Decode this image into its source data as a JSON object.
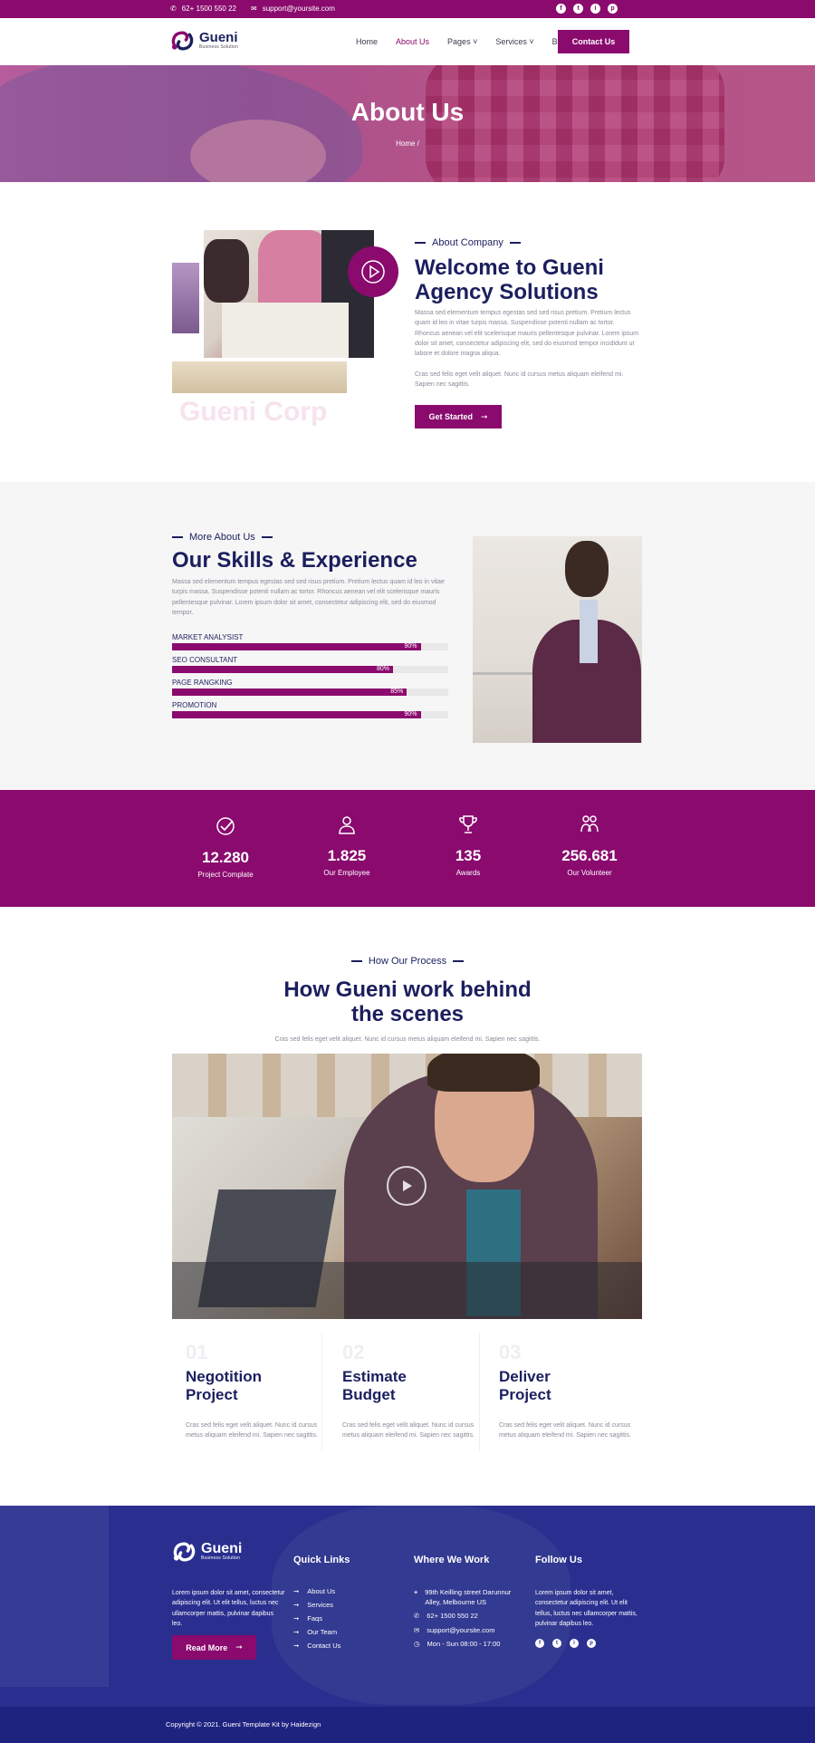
{
  "topbar": {
    "phone": "62+ 1500 550 22",
    "email": "support@yoursite.com",
    "social": [
      "f",
      "t",
      "i",
      "p"
    ]
  },
  "brand": {
    "name": "Gueni",
    "tagline": "Business Solution"
  },
  "nav": {
    "items": [
      {
        "label": "Home"
      },
      {
        "label": "About Us",
        "active": true
      },
      {
        "label": "Pages ˅"
      },
      {
        "label": "Services ˅"
      },
      {
        "label": "Blog"
      }
    ],
    "contact_label": "Contact Us"
  },
  "hero": {
    "title": "About Us",
    "crumb_home": "Home /",
    "crumb_current": ""
  },
  "about": {
    "eyebrow": "About Company",
    "title_line1": "Welcome to Gueni",
    "title_line2": "Agency Solutions",
    "para1": "Massa sed elementum tempus egestas sed sed risus pretium. Pretium lectus quam id leo in vitae turpis massa. Suspendisse potenti nullam ac tortor. Rhoncus aenean vel elit scelerisque mauris pellentesque pulvinar. Lorem ipsum dolor sit amet, consectetur adipiscing elit, sed do eiusmod tempor incididunt ut labore et dolore magna aliqua.",
    "para2": "Cras sed felis eget velit aliquet. Nunc id cursus metus aliquam eleifend mi. Sapien nec sagittis.",
    "cta": "Get Started",
    "watermark": "Gueni Corp"
  },
  "skills": {
    "eyebrow": "More About Us",
    "title": "Our Skills & Experience",
    "para": "Massa sed elementum tempus egestas sed sed risus pretium. Pretium lectus quam id leo in vitae turpis massa. Suspendisse potenti nullam ac tortor. Rhoncus aenean vel elit scelerisque mauris pellentesque pulvinar. Lorem ipsum dolor sit amet, consectetur adipiscing elit, sed do eiusmod tempor.",
    "bars": [
      {
        "label": "MARKET ANALYSIST",
        "value": 90,
        "pct": "90%"
      },
      {
        "label": "SEO CONSULTANT",
        "value": 80,
        "pct": "80%"
      },
      {
        "label": "PAGE RANGKING",
        "value": 85,
        "pct": "85%"
      },
      {
        "label": "PROMOTION",
        "value": 90,
        "pct": "90%"
      }
    ]
  },
  "counters": [
    {
      "num": "12.280",
      "label": "Project Complate",
      "icon": "badge-check-icon"
    },
    {
      "num": "1.825",
      "label": "Our Employee",
      "icon": "employee-icon"
    },
    {
      "num": "135",
      "label": "Awards",
      "icon": "trophy-icon"
    },
    {
      "num": "256.681",
      "label": "Our Volunteer",
      "icon": "volunteer-icon"
    }
  ],
  "process": {
    "eyebrow": "How Our Process",
    "title_line1": "How Gueni work behind",
    "title_line2": "the scenes",
    "subtitle": "Cras sed felis eget velit aliquet. Nunc id cursus metus aliquam eleifend mi. Sapien nec sagittis.",
    "steps": [
      {
        "num": "01",
        "title1": "Negotition",
        "title2": "Project",
        "desc": "Cras sed felis eget velit aliquet. Nunc id cursus metus aliquam eleifend mi. Sapien nec sagittis."
      },
      {
        "num": "02",
        "title1": "Estimate",
        "title2": "Budget",
        "desc": "Cras sed felis eget velit aliquet. Nunc id cursus metus aliquam eleifend mi. Sapien nec sagittis."
      },
      {
        "num": "03",
        "title1": "Deliver",
        "title2": "Project",
        "desc": "Cras sed felis eget velit aliquet. Nunc id cursus metus aliquam eleifend mi. Sapien nec sagittis."
      }
    ]
  },
  "footer": {
    "about_text": "Lorem ipsum dolor sit amet, consectetur adipiscing elit. Ut elit tellus, luctus nec ullamcorper mattis, pulvinar dapibus leo.",
    "read_more": "Read More",
    "quick_title": "Quick Links",
    "quick_links": [
      "About Us",
      "Services",
      "Faqs",
      "Our Team",
      "Contact Us"
    ],
    "work_title": "Where We Work",
    "address_line1": "99th Keilling street Darunnur",
    "address_line2": "Alley, Melbourne US",
    "phone": "62+ 1500 550 22",
    "email": "support@yoursite.com",
    "hours": "Mon - Sun 08:00 - 17:00",
    "follow_title": "Follow Us",
    "follow_text": "Lorem ipsum dolor sit amet, consectetur adipiscing elit. Ut elit tellus, luctus nec ullamcorper mattis, pulvinar dapibus leo.",
    "social": [
      "f",
      "t",
      "i",
      "p"
    ],
    "copyright": "Copyright © 2021. Gueni Template Kit by Haidezign"
  },
  "colors": {
    "primary": "#8a0a6e",
    "navy": "#1b1f5e",
    "footer": "#2a2f8f"
  }
}
